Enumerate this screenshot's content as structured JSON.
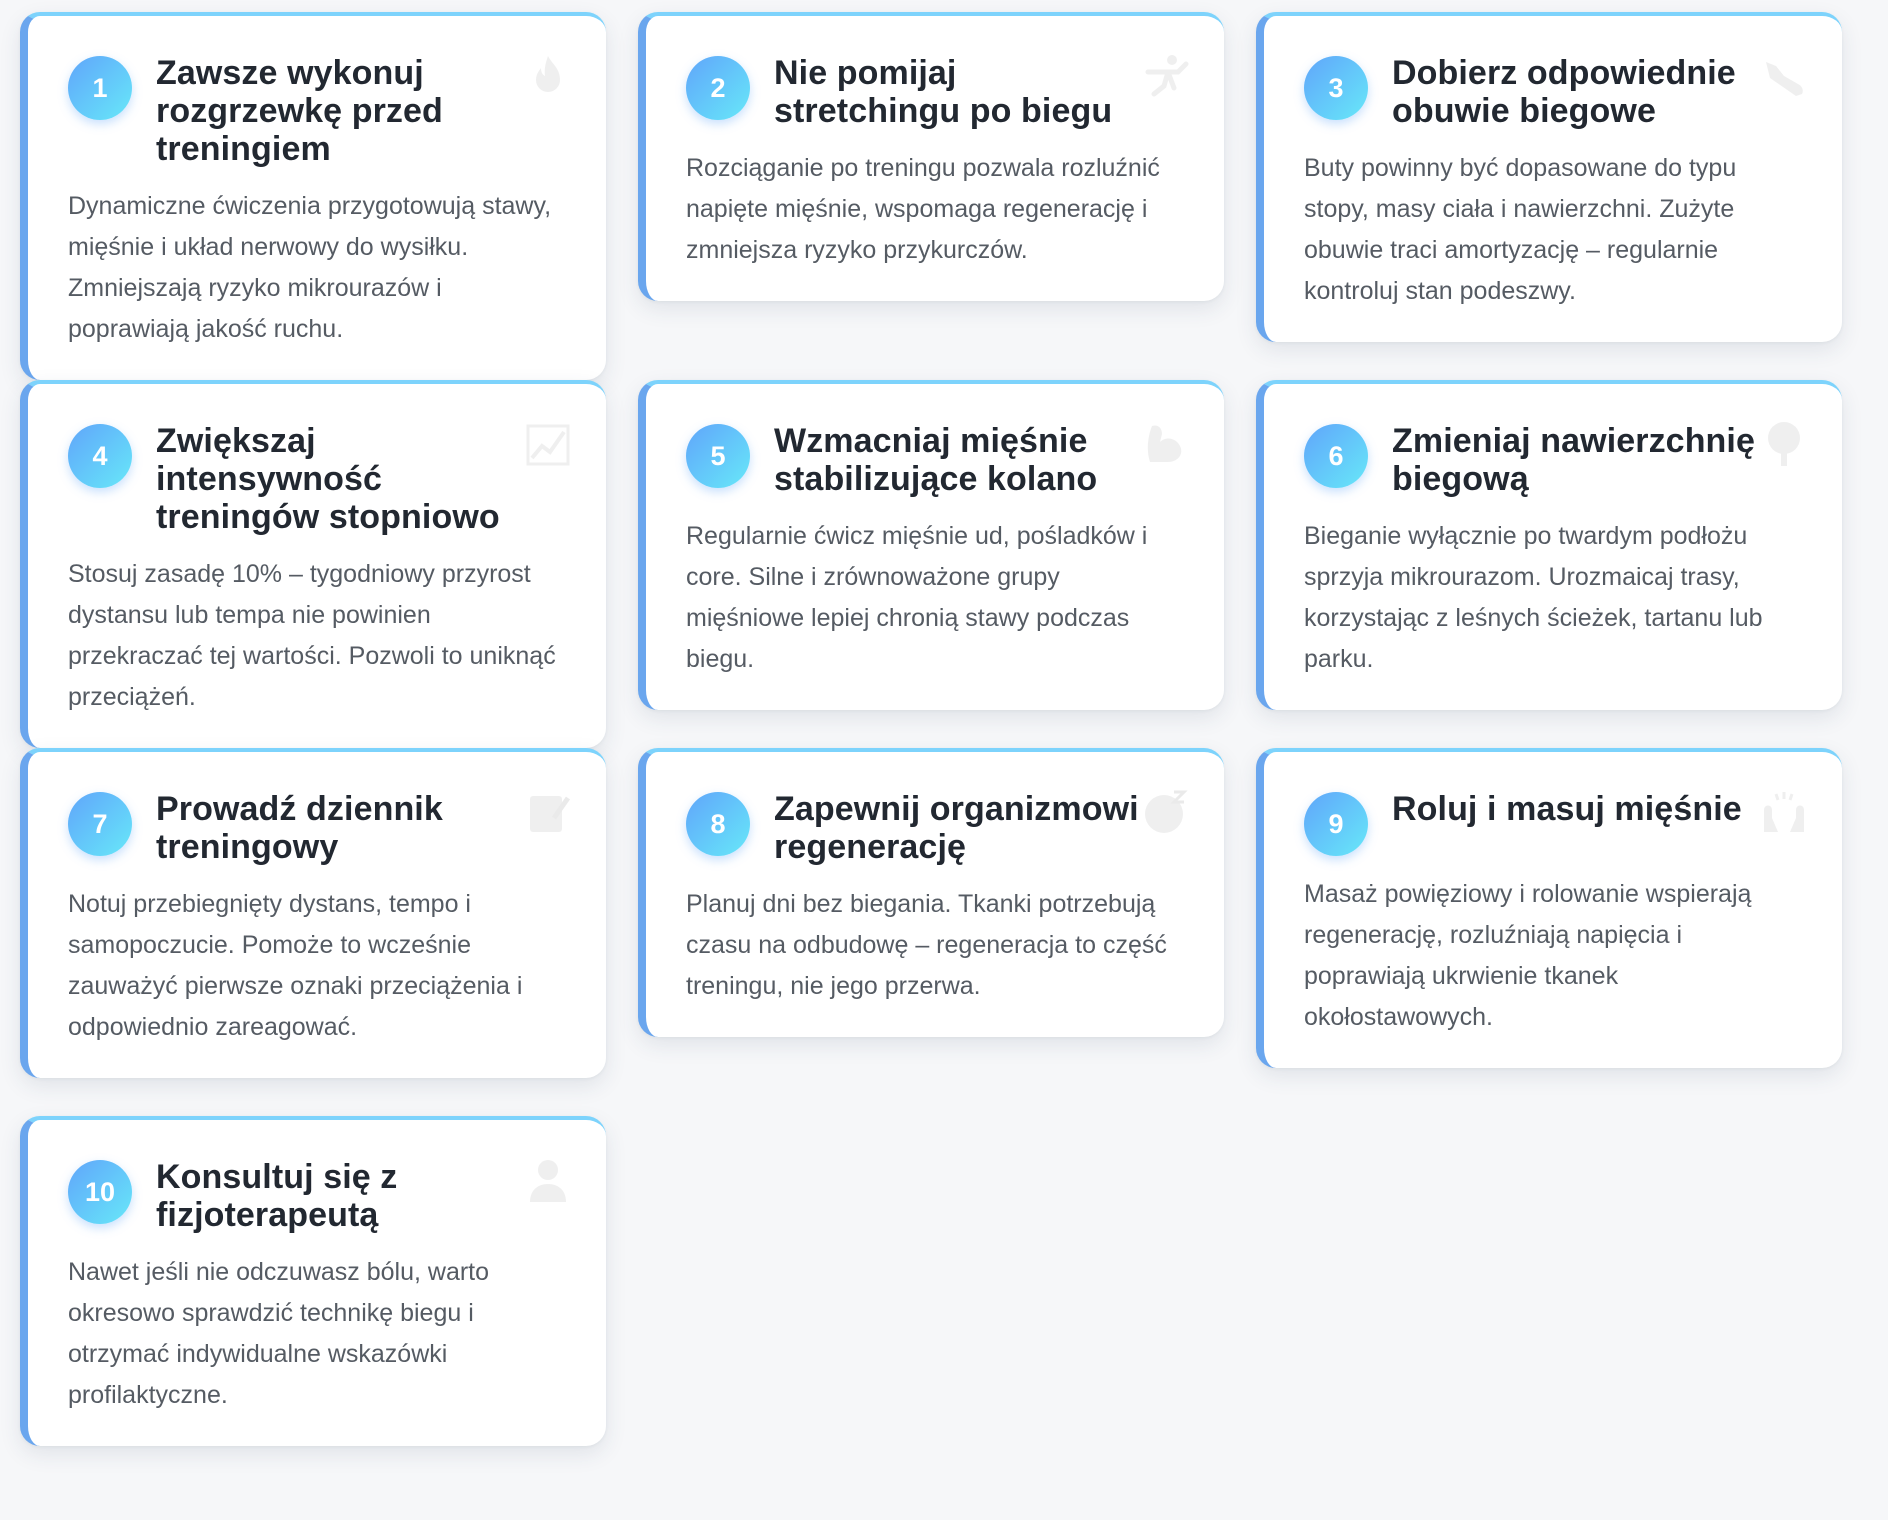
{
  "tips": [
    {
      "number": "1",
      "title": "Zawsze wykonuj rozgrzewkę przed treningiem",
      "description": "Dynamiczne ćwiczenia przygotowują stawy, mięśnie i układ nerwowy do wysiłku. Zmniejszają ryzyko mikrourazów i poprawiają jakość ruchu.",
      "icon": "fire-icon"
    },
    {
      "number": "2",
      "title": "Nie pomijaj stretchingu po biegu",
      "description": "Rozciąganie po treningu pozwala rozluźnić napięte mięśnie, wspomaga regenerację i zmniejsza ryzyko przykurczów.",
      "icon": "stretching-person-icon"
    },
    {
      "number": "3",
      "title": "Dobierz odpowiednie obuwie biegowe",
      "description": "Buty powinny być dopasowane do typu stopy, masy ciała i nawierzchni. Zużyte obuwie traci amortyzację – regularnie kontroluj stan podeszwy.",
      "icon": "running-shoe-icon"
    },
    {
      "number": "4",
      "title": "Zwiększaj intensywność treningów stopniowo",
      "description": "Stosuj zasadę 10% – tygodniowy przyrost dystansu lub tempa nie powinien przekraczać tej wartości. Pozwoli to uniknąć przeciążeń.",
      "icon": "trend-up-chart-icon"
    },
    {
      "number": "5",
      "title": "Wzmacniaj mięśnie stabilizujące kolano",
      "description": "Regularnie ćwicz mięśnie ud, pośladków i core. Silne i zrównoważone grupy mięśniowe lepiej chronią stawy podczas biegu.",
      "icon": "flexed-biceps-icon"
    },
    {
      "number": "6",
      "title": "Zmieniaj nawierzchnię biegową",
      "description": "Bieganie wyłącznie po twardym podłożu sprzyja mikrourazom. Urozmaicaj trasy, korzystając z leśnych ścieżek, tartanu lub parku.",
      "icon": "tree-icon"
    },
    {
      "number": "7",
      "title": "Prowadź dziennik treningowy",
      "description": "Notuj przebiegnięty dystans, tempo i samopoczucie. Pomoże to wcześnie zauważyć pierwsze oznaki przeciążenia i odpowiednio zareagować.",
      "icon": "notepad-icon"
    },
    {
      "number": "8",
      "title": "Zapewnij organizmowi regenerację",
      "description": "Planuj dni bez biegania. Tkanki potrzebują czasu na odbudowę – regeneracja to część treningu, nie jego przerwa.",
      "icon": "sleeping-face-icon"
    },
    {
      "number": "9",
      "title": "Roluj i masuj mięśnie",
      "description": "Masaż powięziowy i rolowanie wspierają regenerację, rozluźniają napięcia i poprawiają ukrwienie tkanek okołostawowych.",
      "icon": "raised-hands-icon"
    },
    {
      "number": "10",
      "title": "Konsultuj się z fizjoterapeutą",
      "description": "Nawet jeśli nie odczuwasz bólu, warto okresowo sprawdzić technikę biegu i otrzymać indywidualne wskazówki profilaktyczne.",
      "icon": "health-worker-icon"
    }
  ],
  "colors": {
    "accent_left": "#6aa6ee",
    "accent_top": "#7dd3fc",
    "badge_start": "#60a5fa",
    "badge_end": "#67e8f9",
    "title": "#222831",
    "text": "#555b63",
    "background": "#f6f7f9"
  }
}
